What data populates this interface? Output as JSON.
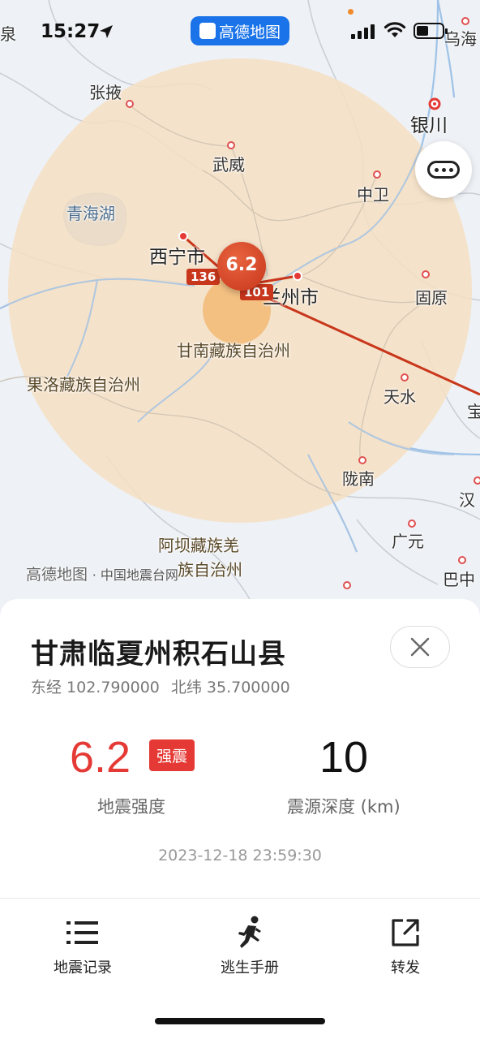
{
  "status_bar": {
    "time": "15:27",
    "app_name": "高德地图"
  },
  "map": {
    "cities": {
      "quan": "泉",
      "wuhai": "乌海",
      "zhangye": "张掖",
      "yinchuan": "银川",
      "wuwei": "武威",
      "zhongwei": "中卫",
      "qinghai_lake": "青海湖",
      "xining": "西宁市",
      "lanzhou": "兰州市",
      "guyuan": "固原",
      "gannan": "甘南藏族自治州",
      "guoluo": "果洛藏族自治州",
      "tianshui": "天水",
      "bao": "宝",
      "longnan": "陇南",
      "han": "汉",
      "guangyuan": "广元",
      "aba_line1": "阿坝藏族羌",
      "aba_line2": "族自治州",
      "bazhong": "巴中"
    },
    "quake_magnitude": "6.2",
    "distance_tag_xining": "136",
    "distance_tag_lanzhou": "101",
    "credit_logo": "高德地图",
    "credit_source": "· 中国地震台网"
  },
  "sheet": {
    "title": "甘肃临夏州积石山县",
    "longitude": "东经 102.790000",
    "latitude": "北纬 35.700000",
    "magnitude": "6.2",
    "magnitude_badge": "强震",
    "magnitude_caption": "地震强度",
    "depth": "10",
    "depth_caption": "震源深度 (km)",
    "event_time": "2023-12-18 23:59:30"
  },
  "actions": {
    "history": "地震记录",
    "escape_guide": "逃生手册",
    "share": "转发"
  },
  "colors": {
    "accent_red": "#e53935",
    "map_brand_blue": "#1a73e8",
    "impact_zone": "#f6dfc2"
  }
}
